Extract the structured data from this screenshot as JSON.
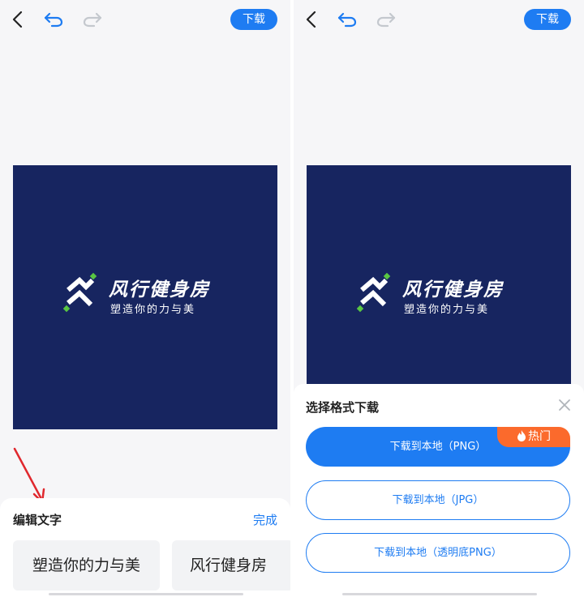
{
  "left": {
    "toolbar": {
      "download_label": "下载"
    },
    "logo": {
      "title": "风行健身房",
      "slogan": "塑造你的力与美"
    },
    "edit_sheet": {
      "title": "编辑文字",
      "done_label": "完成",
      "chips": [
        "塑造你的力与美",
        "风行健身房"
      ]
    }
  },
  "right": {
    "toolbar": {
      "download_label": "下载"
    },
    "logo": {
      "title": "风行健身房",
      "slogan": "塑造你的力与美"
    },
    "download_sheet": {
      "title": "选择格式下载",
      "hot_badge": "热门",
      "options": [
        "下载到本地（PNG）",
        "下载到本地（JPG）",
        "下载到本地（透明底PNG）"
      ]
    }
  },
  "colors": {
    "accent": "#1e7cf2",
    "canvas_bg": "#172560",
    "hot": "#fb6a2c",
    "arrow": "#e0282e",
    "logo_green": "#59c642"
  }
}
